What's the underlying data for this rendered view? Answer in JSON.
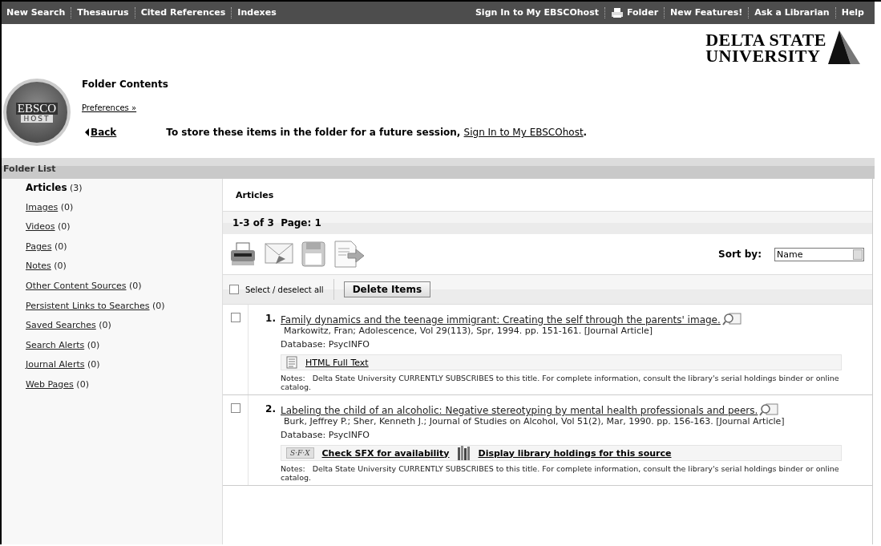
{
  "top_nav": {
    "left": [
      {
        "label": "New Search"
      },
      {
        "label": "Thesaurus"
      },
      {
        "label": "Cited References"
      },
      {
        "label": "Indexes"
      }
    ],
    "right": [
      {
        "label": "Sign In to My EBSCOhost",
        "kind": "text"
      },
      {
        "label": "Folder",
        "kind": "folder"
      },
      {
        "label": "New Features!",
        "kind": "text"
      },
      {
        "label": "Ask a Librarian",
        "kind": "text"
      },
      {
        "label": "Help",
        "kind": "text"
      }
    ]
  },
  "header": {
    "logo": {
      "top": "EBSCO",
      "bottom": "HOST"
    },
    "university": [
      "DELTA STATE",
      "UNIVERSITY"
    ],
    "title": "Folder Contents",
    "preferences": "Preferences »",
    "back": "Back",
    "message": "To store these items in the folder for a future session, ",
    "message_link": "Sign In to My EBSCOhost",
    "message_end": "."
  },
  "folder_list": {
    "title": "Folder List",
    "items": [
      {
        "label": "Articles",
        "count": "(3)",
        "selected": true
      },
      {
        "label": "Images",
        "count": "(0)",
        "selected": false
      },
      {
        "label": "Videos",
        "count": "(0)",
        "selected": false
      },
      {
        "label": "Pages",
        "count": "(0)",
        "selected": false
      },
      {
        "label": "Notes",
        "count": "(0)",
        "selected": false
      },
      {
        "label": "Other Content Sources",
        "count": "(0)",
        "selected": false
      },
      {
        "label": "Persistent Links to Searches",
        "count": "(0)",
        "selected": false
      },
      {
        "label": "Saved Searches",
        "count": "(0)",
        "selected": false
      },
      {
        "label": "Search Alerts",
        "count": "(0)",
        "selected": false
      },
      {
        "label": "Journal Alerts",
        "count": "(0)",
        "selected": false
      },
      {
        "label": "Web Pages",
        "count": "(0)",
        "selected": false
      }
    ]
  },
  "content": {
    "title": "Articles",
    "pagination": "1-3 of 3  Page: 1",
    "sort_label": "Sort by:",
    "sort_value": "Name",
    "select_all": {
      "label": "Select / deselect all",
      "checked": false
    },
    "delete_button": "Delete Items",
    "results": [
      {
        "number": "1.",
        "checked": false,
        "title": "Family dynamics and the teenage immigrant: Creating the self through the parents' image.",
        "citation": "Markowitz, Fran; Adolescence, Vol 29(113), Spr, 1994. pp. 151-161. [Journal Article]",
        "database": "Database: PsycINFO",
        "links": [
          {
            "kind": "html",
            "label": "HTML Full Text"
          }
        ],
        "notes": "Notes:   Delta State University CURRENTLY SUBSCRIBES to this title. For complete information, consult the library's serial holdings binder or online catalog."
      },
      {
        "number": "2.",
        "checked": false,
        "title": "Labeling the child of an alcoholic: Negative stereotyping by mental health professionals and peers.",
        "citation": "Burk, Jeffrey P.; Sher, Kenneth J.; Journal of Studies on Alcohol, Vol 51(2), Mar, 1990. pp. 156-163. [Journal Article]",
        "database": "Database: PsycINFO",
        "links": [
          {
            "kind": "sfx",
            "label": "Check SFX for availability",
            "badge": "S·F·X"
          },
          {
            "kind": "holdings",
            "label": "Display library holdings for this source"
          }
        ],
        "notes": "Notes:   Delta State University CURRENTLY SUBSCRIBES to this title. For complete information, consult the library's serial holdings binder or online catalog."
      }
    ]
  }
}
